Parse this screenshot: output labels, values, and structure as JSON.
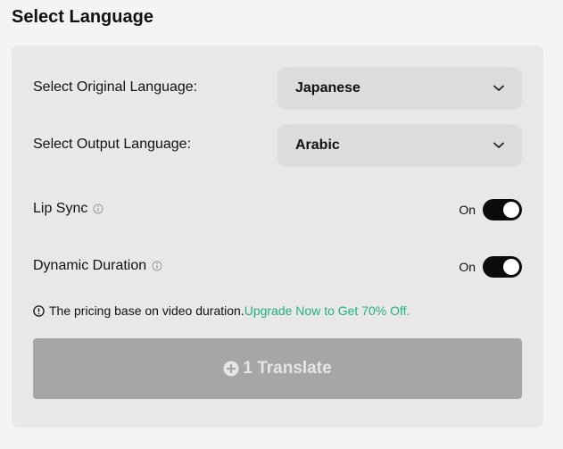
{
  "section_title": "Select Language",
  "original_language": {
    "label": "Select Original Language:",
    "value": "Japanese",
    "icon": "chevron-down-icon"
  },
  "output_language": {
    "label": "Select Output Language:",
    "value": "Arabic",
    "icon": "chevron-down-icon"
  },
  "lip_sync": {
    "label": "Lip Sync",
    "state": "On",
    "enabled": true,
    "info_icon": "info-icon"
  },
  "dynamic_duration": {
    "label": "Dynamic Duration",
    "state": "On",
    "enabled": true,
    "info_icon": "info-icon"
  },
  "notice": {
    "icon": "info-circle-icon",
    "text": "The pricing base on video duration.",
    "link_text": "Upgrade Now to Get 70% Off.",
    "link_color": "#22b07d"
  },
  "translate_button": {
    "icon": "plus-coin-icon",
    "label": "1 Translate",
    "background": "#a6a6a6"
  }
}
